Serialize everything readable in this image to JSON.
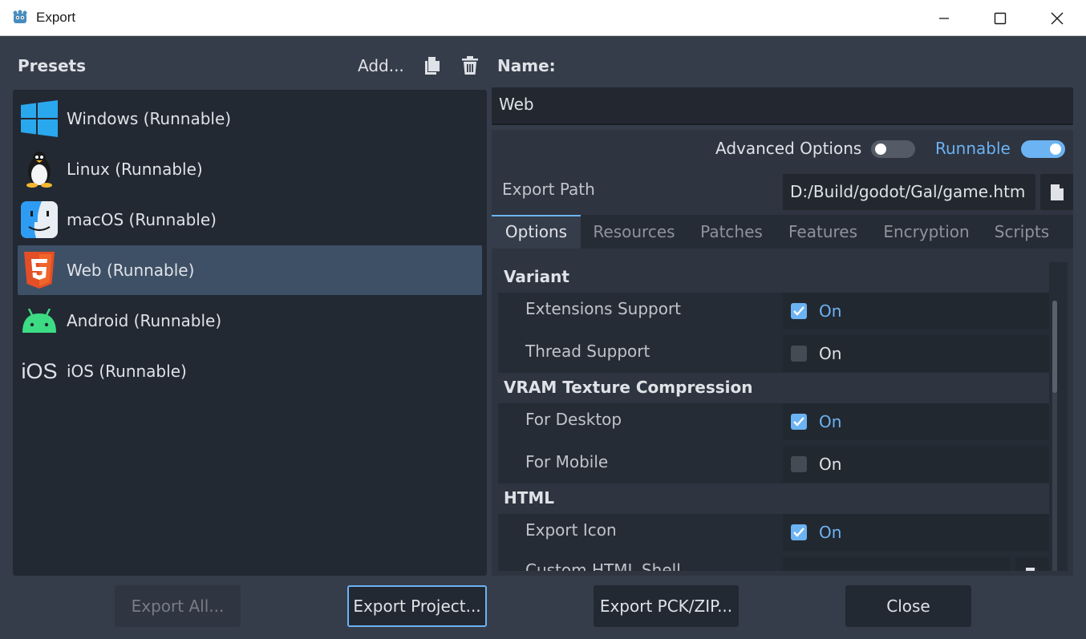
{
  "window": {
    "title": "Export"
  },
  "presets": {
    "header": "Presets",
    "add_label": "Add...",
    "items": [
      {
        "label": "Windows (Runnable)",
        "icon": "windows-icon",
        "selected": false
      },
      {
        "label": "Linux (Runnable)",
        "icon": "linux-icon",
        "selected": false
      },
      {
        "label": "macOS (Runnable)",
        "icon": "macos-icon",
        "selected": false
      },
      {
        "label": "Web (Runnable)",
        "icon": "html5-icon",
        "selected": true
      },
      {
        "label": "Android (Runnable)",
        "icon": "android-icon",
        "selected": false
      },
      {
        "label": "iOS (Runnable)",
        "icon": "ios-icon",
        "selected": false
      }
    ],
    "ios_icon_text": "iOS"
  },
  "detail": {
    "name_label": "Name:",
    "name_value": "Web",
    "advanced_options_label": "Advanced Options",
    "advanced_options_on": false,
    "runnable_label": "Runnable",
    "runnable_on": true,
    "export_path_label": "Export Path",
    "export_path_value": "D:/Build/godot/Gal/game.htm",
    "tabs": [
      "Options",
      "Resources",
      "Patches",
      "Features",
      "Encryption",
      "Scripts"
    ],
    "active_tab": "Options",
    "sections": {
      "variant": {
        "title": "Variant",
        "extensions_support": {
          "label": "Extensions Support",
          "value": "On",
          "checked": true
        },
        "thread_support": {
          "label": "Thread Support",
          "value": "On",
          "checked": false
        }
      },
      "vram": {
        "title": "VRAM Texture Compression",
        "for_desktop": {
          "label": "For Desktop",
          "value": "On",
          "checked": true
        },
        "for_mobile": {
          "label": "For Mobile",
          "value": "On",
          "checked": false
        }
      },
      "html": {
        "title": "HTML",
        "export_icon": {
          "label": "Export Icon",
          "value": "On",
          "checked": true
        },
        "custom_html_shell": {
          "label": "Custom HTML Shell"
        }
      }
    }
  },
  "footer": {
    "export_all": "Export All...",
    "export_project": "Export Project...",
    "export_pck_zip": "Export PCK/ZIP...",
    "close": "Close"
  },
  "colors": {
    "accent": "#6cb3f3",
    "selected_row": "#3e5066",
    "background": "#363d4a"
  }
}
